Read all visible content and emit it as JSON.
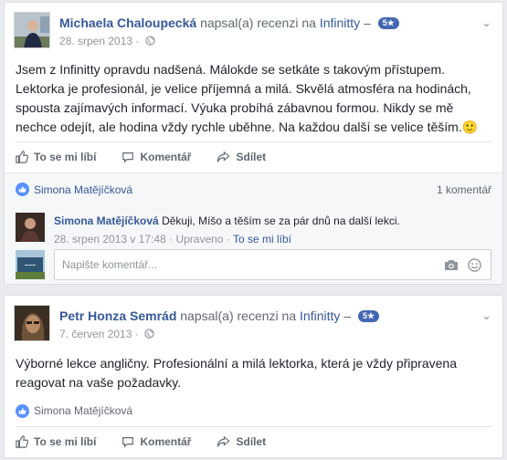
{
  "review1": {
    "author": "Michaela Chaloupecká",
    "verb": "napsal(a) recenzi na",
    "page": "Infinitty",
    "dash": "–",
    "rating": "5★",
    "date": "28. srpen 2013 ·",
    "body": "Jsem z Infinitty opravdu nadšená. Málokde se setkáte s takovým přístupem. Lektorka je profesionál, je velice příjemná a milá. Skvělá atmosféra na hodinách, spousta zajímavých informací. Výuka probíhá zábavnou formou. Nikdy se mě nechce odejít, ale hodina vždy rychle uběhne. Na každou další se velice těším.",
    "emoji": "🙂",
    "actions": {
      "like": "To se mi líbí",
      "comment": "Komentář",
      "share": "Sdílet"
    },
    "likes": {
      "name": "Simona Matějíčková",
      "count": "1 komentář"
    },
    "comment": {
      "author": "Simona Matějíčková",
      "text": "Děkuji, Míšo a těším se za pár dnů na další lekci.",
      "date": "28. srpen 2013 v 17:48",
      "sep1": "·",
      "edited": "Upraveno",
      "sep2": "·",
      "like": "To se mi líbí"
    },
    "write": {
      "placeholder": "Napište komentář..."
    }
  },
  "review2": {
    "author": "Petr Honza Semrád",
    "verb": "napsal(a) recenzi na",
    "page": "Infinitty",
    "dash": "–",
    "rating": "5★",
    "date": "7. červen 2013 ·",
    "body": "Výborné lekce angličny. Profesionální a milá lektorka, která je vždy připravena reagovat na vaše požadavky.",
    "actions": {
      "like": "To se mi líbí",
      "comment": "Komentář",
      "share": "Sdílet"
    },
    "likes": {
      "name": "Simona Matějíčková"
    }
  }
}
